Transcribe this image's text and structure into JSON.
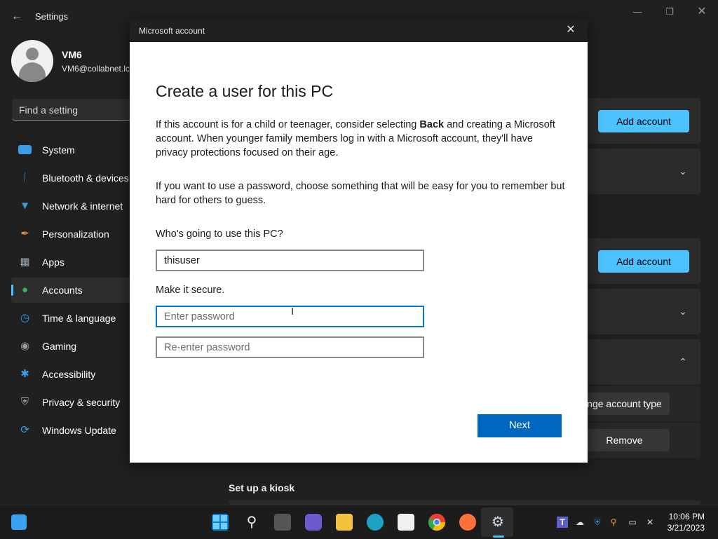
{
  "settings": {
    "title": "Settings",
    "user": {
      "name": "VM6",
      "email": "VM6@collabnet.lc"
    },
    "search_placeholder": "Find a setting",
    "nav": [
      {
        "label": "System",
        "icon": "monitor-icon",
        "color": "#3b9ee8"
      },
      {
        "label": "Bluetooth & devices",
        "icon": "bluetooth-icon",
        "color": "#3b9ee8"
      },
      {
        "label": "Network & internet",
        "icon": "wifi-icon",
        "color": "#3b9ee8"
      },
      {
        "label": "Personalization",
        "icon": "paintbrush-icon",
        "color": "#e08a3a"
      },
      {
        "label": "Apps",
        "icon": "apps-icon",
        "color": "#9aa7b5"
      },
      {
        "label": "Accounts",
        "icon": "person-icon",
        "color": "#2fb36e"
      },
      {
        "label": "Time & language",
        "icon": "clock-globe-icon",
        "color": "#3b9ee8"
      },
      {
        "label": "Gaming",
        "icon": "gamepad-icon",
        "color": "#9a9a9a"
      },
      {
        "label": "Accessibility",
        "icon": "accessibility-icon",
        "color": "#3b9ee8"
      },
      {
        "label": "Privacy & security",
        "icon": "shield-icon",
        "color": "#9a9a9a"
      },
      {
        "label": "Windows Update",
        "icon": "refresh-icon",
        "color": "#3b9ee8"
      }
    ],
    "active_nav": "Accounts",
    "content": {
      "add_account_1": "Add account",
      "add_account_2": "Add account",
      "change_account_type": "nge account type",
      "remove": "Remove",
      "kiosk_heading": "Set up a kiosk"
    }
  },
  "dialog": {
    "title": "Microsoft account",
    "heading": "Create a user for this PC",
    "para1_before": "If this account is for a child or teenager, consider selecting ",
    "para1_bold": "Back",
    "para1_after": " and creating a Microsoft account. When younger family members log in with a Microsoft account, they'll have privacy protections focused on their age.",
    "para2": "If you want to use a password, choose something that will be easy for you to remember but hard for others to guess.",
    "who_label": "Who's going to use this PC?",
    "username_value": "thisuser",
    "secure_label": "Make it secure.",
    "password_placeholder": "Enter password",
    "reenter_placeholder": "Re-enter password",
    "next_label": "Next"
  },
  "taskbar": {
    "apps": [
      {
        "name": "start-icon"
      },
      {
        "name": "search-icon"
      },
      {
        "name": "task-view-icon"
      },
      {
        "name": "chat-icon"
      },
      {
        "name": "file-explorer-icon"
      },
      {
        "name": "edge-icon"
      },
      {
        "name": "store-icon"
      },
      {
        "name": "chrome-icon"
      },
      {
        "name": "firefox-icon"
      },
      {
        "name": "settings-icon"
      }
    ],
    "time": "10:06 PM",
    "date": "3/21/2023"
  }
}
